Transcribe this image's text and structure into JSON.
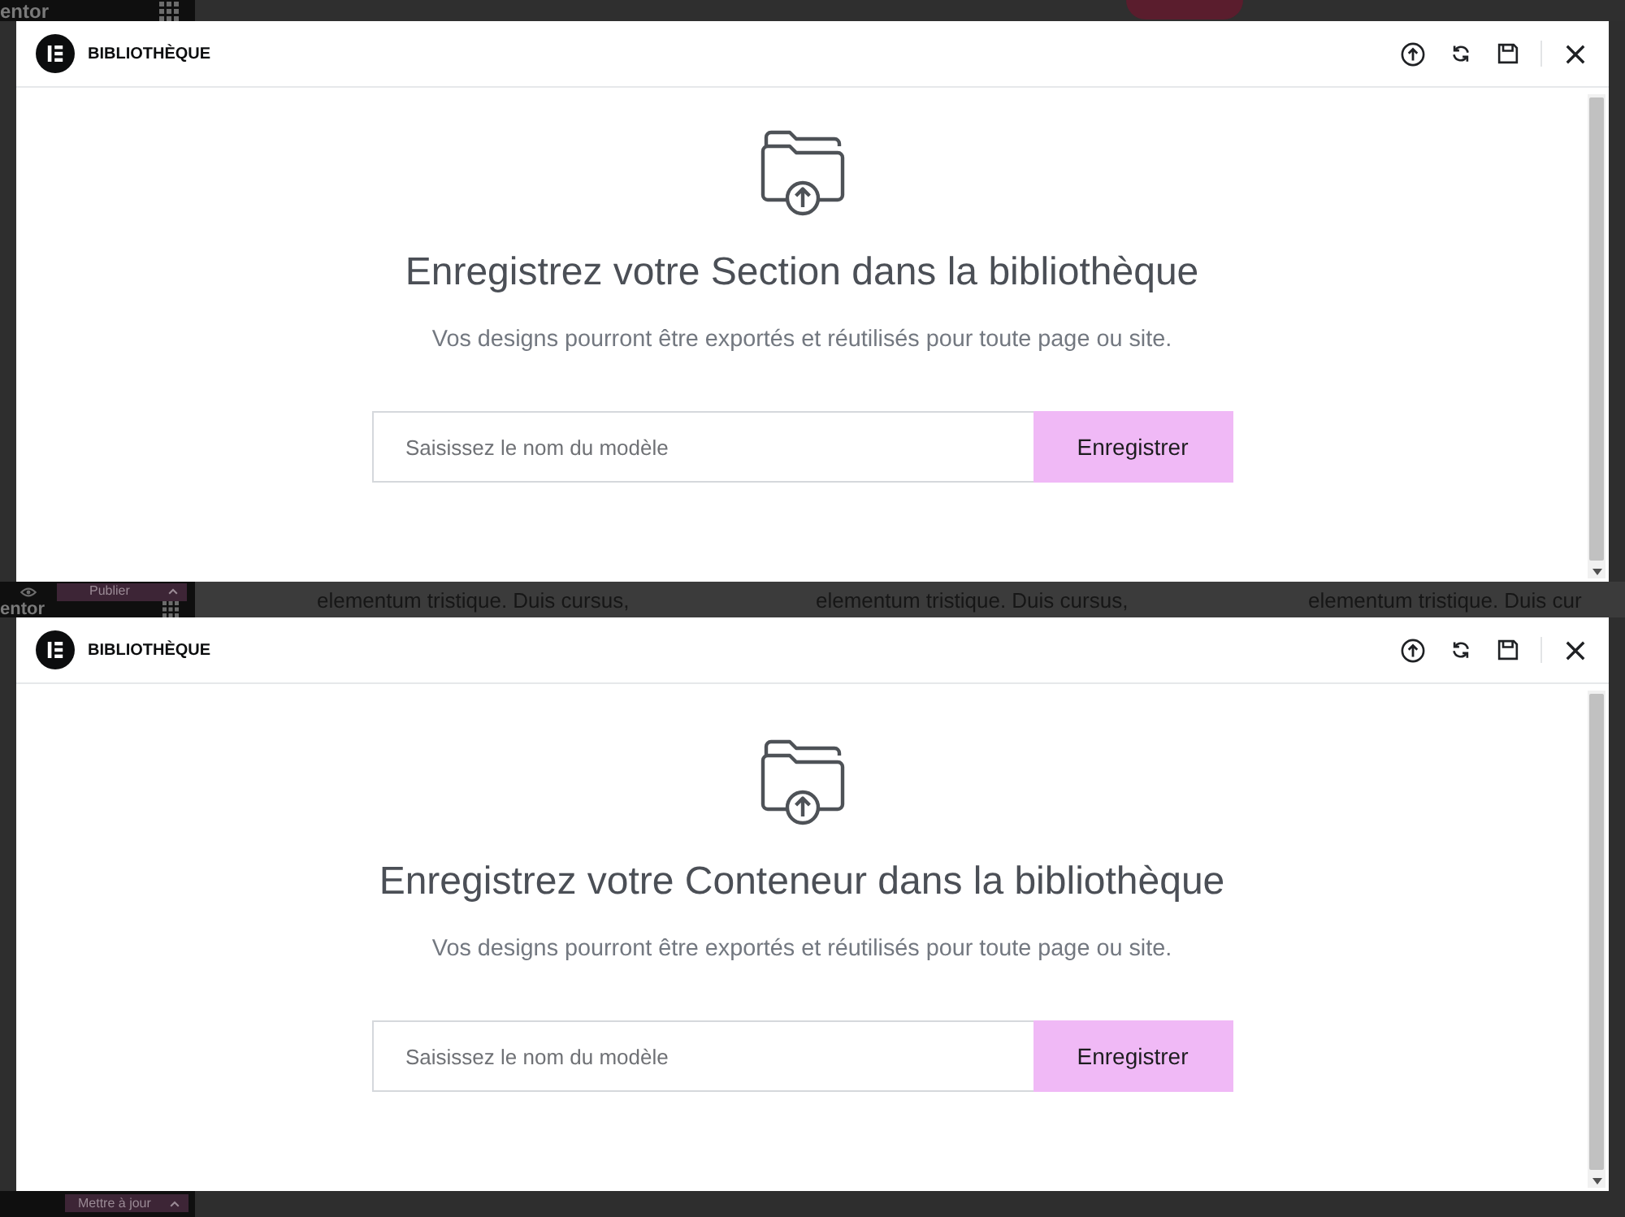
{
  "backdrop": {
    "top_bar": {
      "logo_text": "entor"
    },
    "editor_panel": {
      "publish_button": "Publier",
      "logo_text": "entor"
    },
    "page_text": [
      "elementum tristique. Duis cursus,",
      "elementum tristique. Duis cursus,",
      "elementum tristique. Duis cur"
    ],
    "update_button": "Mettre à jour"
  },
  "dialogs": [
    {
      "title": "BIBLIOTHÈQUE",
      "heading": "Enregistrez votre Section dans la bibliothèque",
      "description": "Vos designs pourront être exportés et réutilisés pour toute page ou site.",
      "name_field": {
        "placeholder": "Saisissez le nom du modèle"
      },
      "save_button": "Enregistrer"
    },
    {
      "title": "BIBLIOTHÈQUE",
      "heading": "Enregistrez votre Conteneur dans la bibliothèque",
      "description": "Vos designs pourront être exportés et réutilisés pour toute page ou site.",
      "name_field": {
        "placeholder": "Saisissez le nom du modèle"
      },
      "save_button": "Enregistrer"
    }
  ]
}
